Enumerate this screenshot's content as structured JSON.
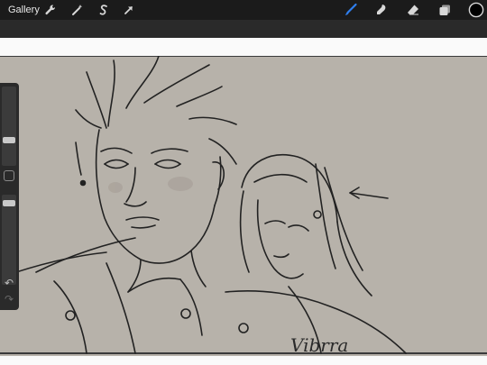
{
  "toolbar": {
    "gallery_label": "Gallery",
    "left_tools": [
      "wrench-icon",
      "magic-wand-icon",
      "selection-s-icon",
      "transform-arrow-icon"
    ],
    "right_tools": [
      "brush-icon",
      "smudge-icon",
      "eraser-icon",
      "layers-icon",
      "color-swatch-icon"
    ],
    "active_tool": "brush-icon",
    "accent": "#2f7ff0",
    "current_color": "#000000"
  },
  "canvas": {
    "paper_color": "#b7b2aa",
    "signature_text": "Vibrra"
  },
  "sidebar": {
    "brush_size_level": 0.62,
    "opacity_level": 0.38,
    "undo_icon": "undo-icon",
    "redo_icon": "redo-icon"
  }
}
